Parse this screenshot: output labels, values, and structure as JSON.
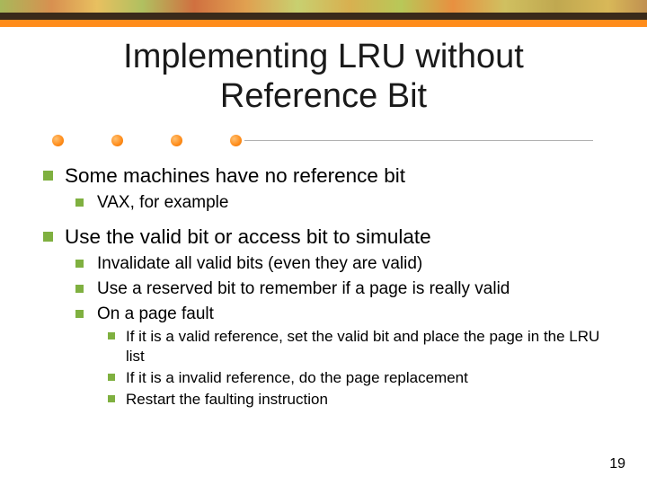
{
  "title_line1": "Implementing LRU without",
  "title_line2": "Reference Bit",
  "bullets": {
    "p1": "Some machines have no reference bit",
    "p1_1": "VAX, for example",
    "p2": "Use the valid bit or access bit to simulate",
    "p2_1": "Invalidate all valid bits (even they are valid)",
    "p2_2": "Use a reserved bit to remember if a page is really valid",
    "p2_3": "On a page fault",
    "p2_3_1": "If it is a valid reference, set the valid bit and place the page in the LRU list",
    "p2_3_2": "If it is a invalid reference, do the page replacement",
    "p2_3_3": "Restart the faulting instruction"
  },
  "page_number": "19"
}
